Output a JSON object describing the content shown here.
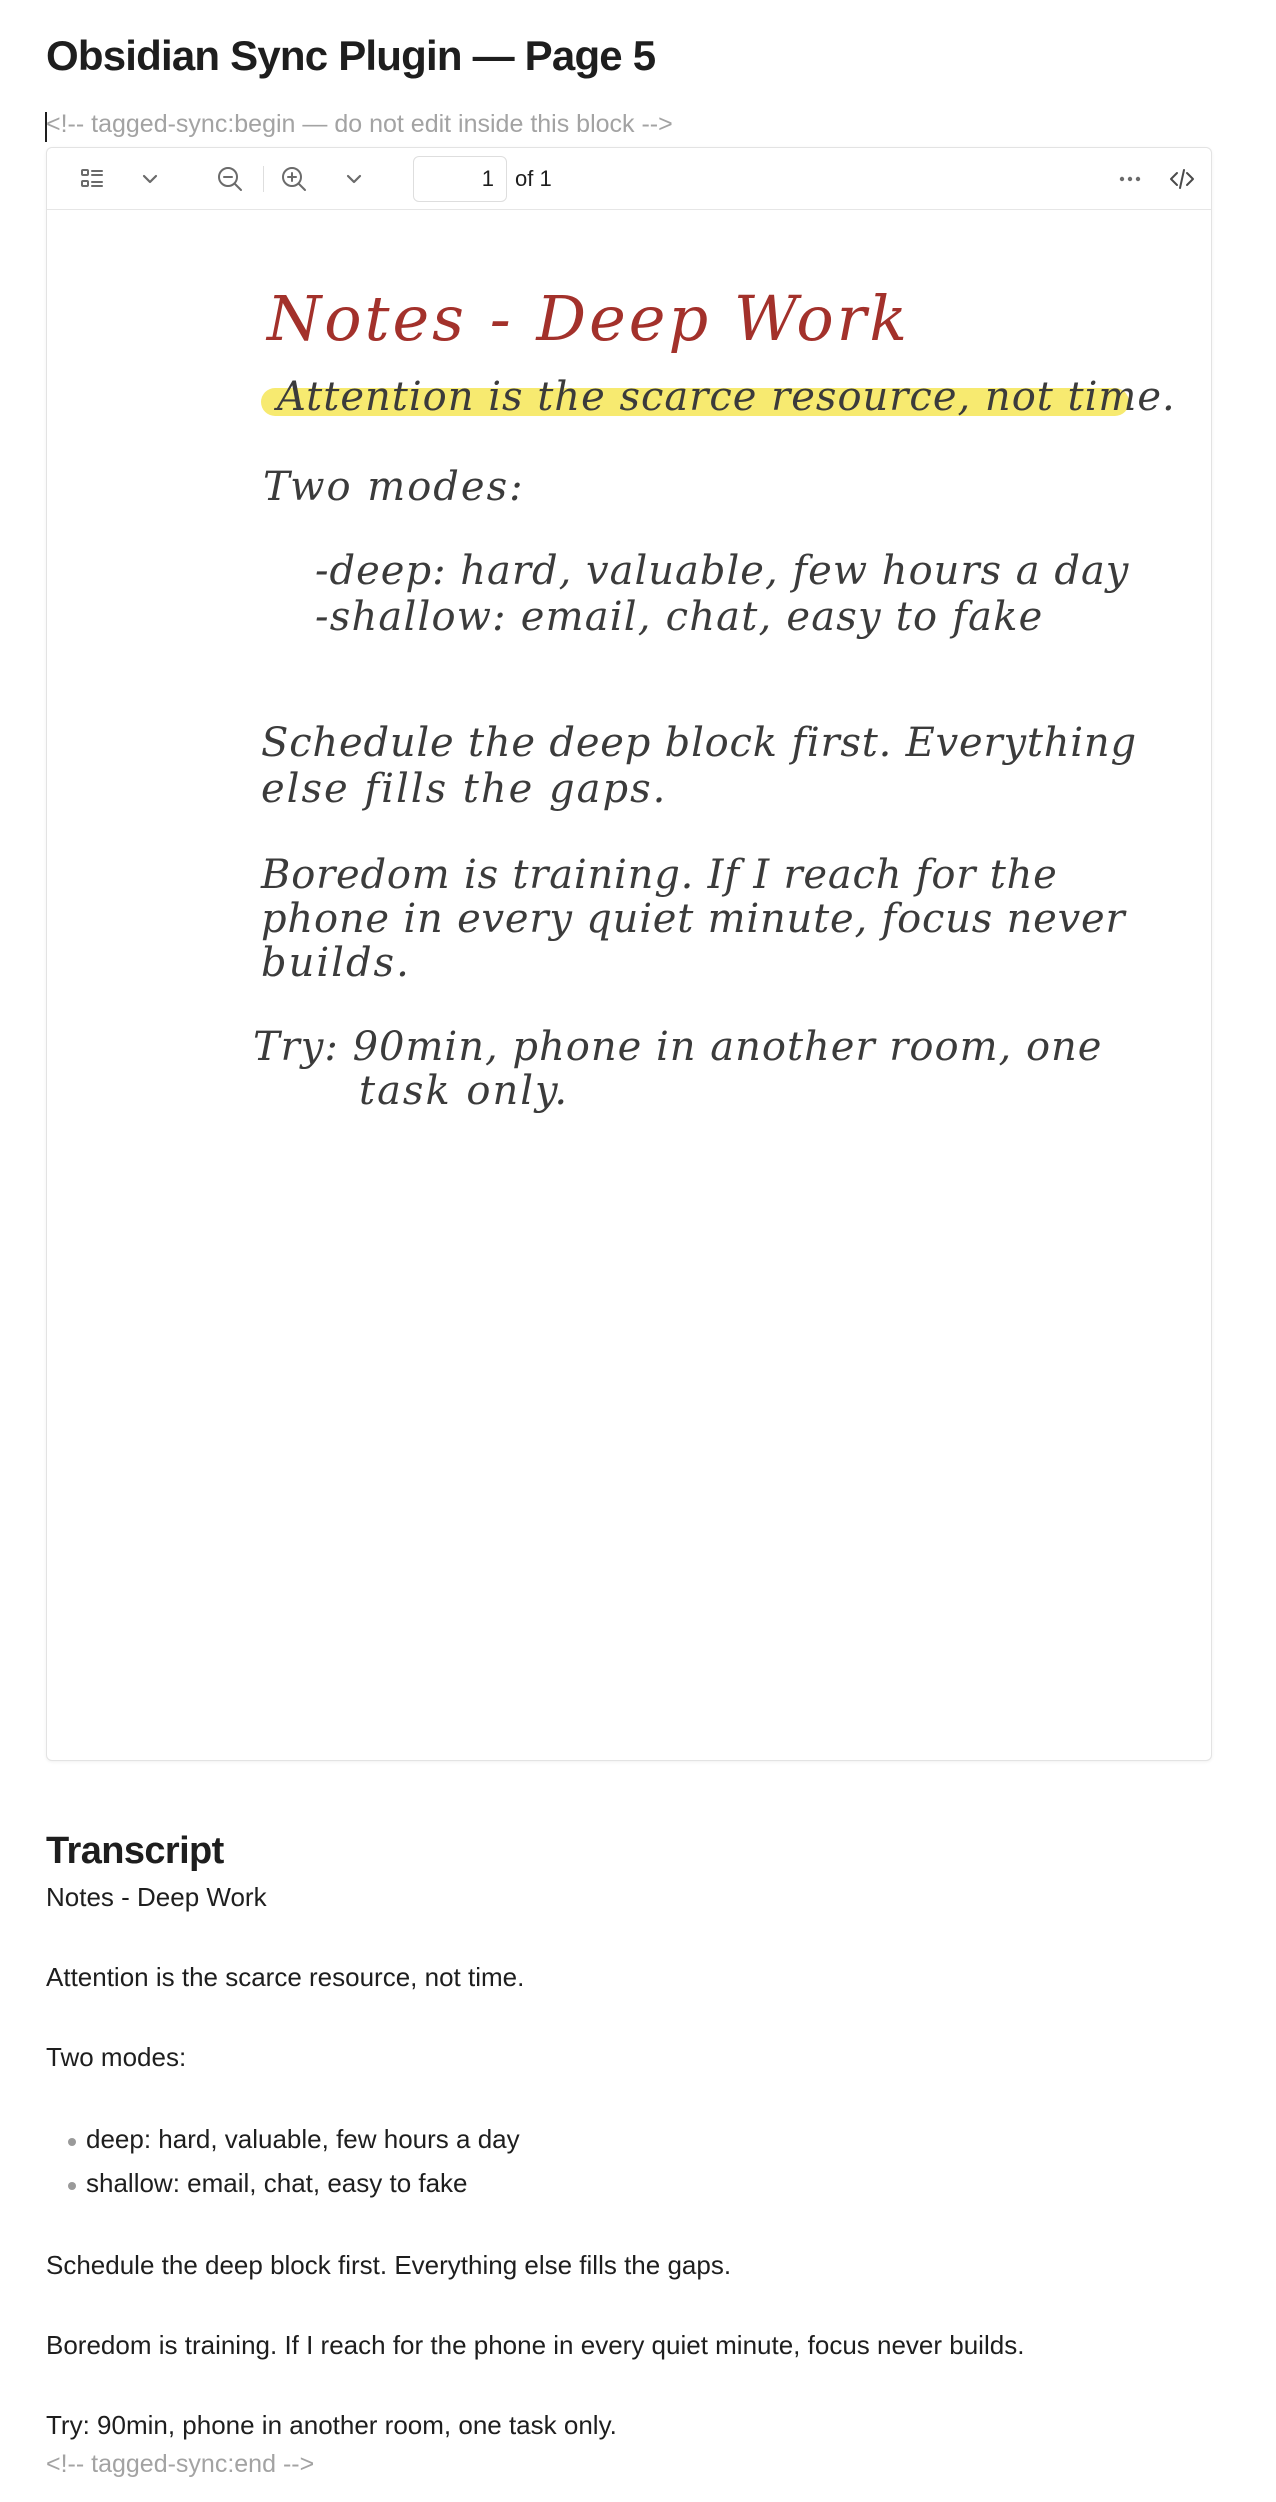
{
  "page": {
    "title": "Obsidian Sync Plugin — Page 5",
    "begin_comment": "<!-- tagged-sync:begin — do not edit inside this block -->",
    "end_comment": "<!-- tagged-sync:end -->"
  },
  "pdf_viewer": {
    "toolbar": {
      "icons": [
        "thumbnails-icon",
        "chevron-down-icon",
        "zoom-out-icon",
        "zoom-in-icon",
        "chevron-down-icon",
        "more-icon",
        "code-icon"
      ],
      "page_input_value": "1",
      "page_total_label": "of 1"
    },
    "handwriting": {
      "title": "Notes - Deep Work",
      "highlighted_line": "Attention is the scarce resource, not time.",
      "modes_label": "Two modes:",
      "mode_deep": "-deep: hard, valuable, few hours a day",
      "mode_shallow": "-shallow: email, chat, easy to fake",
      "schedule_line1": "Schedule the deep block first. Everything",
      "schedule_line2": "else fills the gaps.",
      "boredom_line1": "Boredom is training. If I reach for the",
      "boredom_line2": "phone in every quiet minute, focus never",
      "boredom_line3": "builds.",
      "try_line1": "Try: 90min, phone in another room, one",
      "try_line2": "task only.",
      "colors": {
        "title": "#a3312b",
        "highlight": "#f6e860",
        "ink": "#3b3b3b"
      }
    }
  },
  "transcript": {
    "heading": "Transcript",
    "title_line": "Notes - Deep Work",
    "line_attention": "Attention is the scarce resource, not time.",
    "line_modes": "Two modes:",
    "bullets": [
      "deep: hard, valuable, few hours a day",
      "shallow: email, chat, easy to fake"
    ],
    "line_schedule": "Schedule the deep block first. Everything else fills the gaps.",
    "line_boredom": "Boredom is training. If I reach for the phone in every quiet minute, focus never builds.",
    "line_try": "Try: 90min, phone in another room, one task only."
  }
}
